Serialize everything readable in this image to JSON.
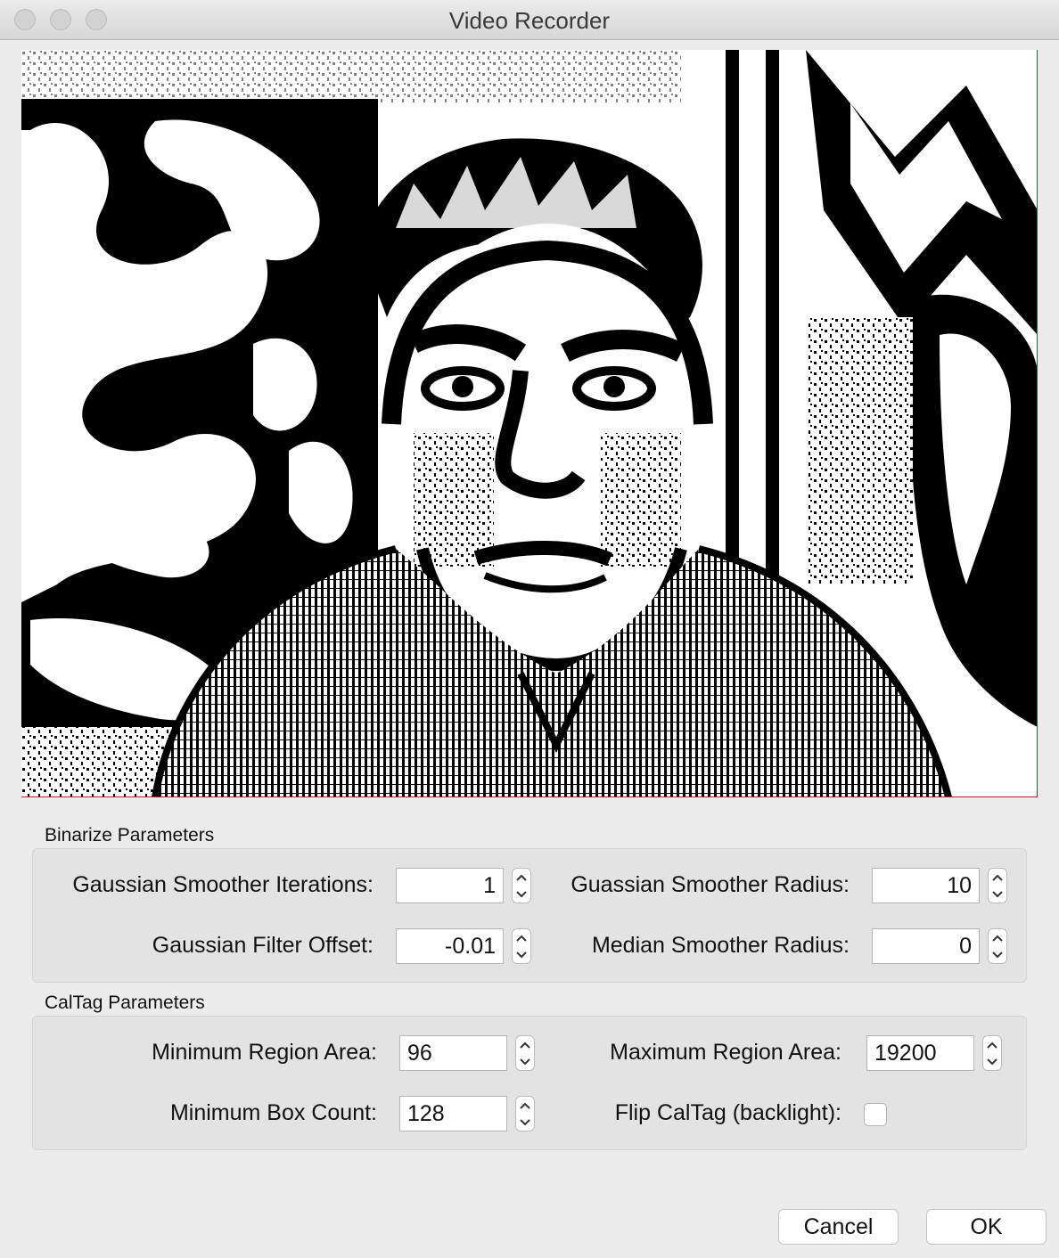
{
  "window": {
    "title": "Video Recorder"
  },
  "binarize": {
    "heading": "Binarize Parameters",
    "iterations_label": "Gaussian Smoother Iterations:",
    "iterations_value": "1",
    "radius_label": "Guassian Smoother Radius:",
    "radius_value": "10",
    "offset_label": "Gaussian Filter Offset:",
    "offset_value": "-0.01",
    "median_label": "Median Smoother Radius:",
    "median_value": "0"
  },
  "caltag": {
    "heading": "CalTag Parameters",
    "min_area_label": "Minimum Region Area:",
    "min_area_value": "96",
    "max_area_label": "Maximum Region Area:",
    "max_area_value": "19200",
    "box_count_label": "Minimum Box Count:",
    "box_count_value": "128",
    "flip_label": "Flip CalTag (backlight):",
    "flip_checked": false
  },
  "buttons": {
    "cancel": "Cancel",
    "ok": "OK"
  },
  "colors": {
    "preview_border": "#c8102e"
  }
}
